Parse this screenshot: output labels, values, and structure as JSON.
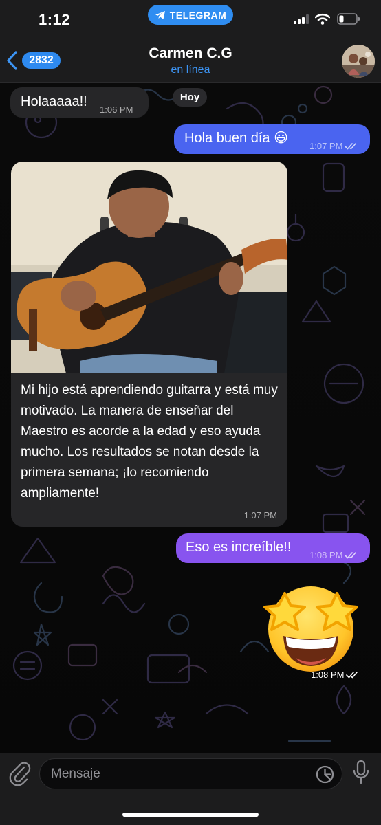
{
  "status_bar": {
    "time": "1:12",
    "pill_label": "TELEGRAM",
    "signal_icon": "cellular-signal-icon",
    "wifi_icon": "wifi-icon",
    "battery_icon": "battery-low-icon"
  },
  "header": {
    "unread_count": "2832",
    "contact_name": "Carmen C.G",
    "contact_status": "en línea",
    "back_icon": "chevron-left-icon"
  },
  "chat": {
    "date_chip": "Hoy",
    "messages": [
      {
        "direction": "incoming",
        "text": "Holaaaaa!!",
        "time": "1:06 PM"
      },
      {
        "direction": "outgoing",
        "text": "Hola buen día 😃",
        "time": "1:07 PM",
        "read": true
      },
      {
        "direction": "incoming",
        "type": "photo",
        "caption": "Mi hijo está aprendiendo guitarra y está muy motivado. La manera de enseñar del Maestro es acorde a la edad y eso ayuda mucho. Los resultados se notan desde la primera semana; ¡lo recomiendo ampliamente!",
        "time": "1:07 PM"
      },
      {
        "direction": "outgoing",
        "text": "Eso es increíble!!",
        "time": "1:08 PM",
        "read": true
      },
      {
        "direction": "outgoing",
        "type": "emoji",
        "emoji": "star-struck",
        "time": "1:08 PM",
        "read": true
      }
    ]
  },
  "input": {
    "placeholder": "Mensaje",
    "attach_icon": "paperclip-icon",
    "sticker_icon": "sticker-clock-icon",
    "mic_icon": "microphone-icon"
  },
  "colors": {
    "accent": "#2f8df1",
    "outgoing_bubble_top": "#4a64f0",
    "outgoing_bubble_bottom": "#8854ef",
    "incoming_bubble": "#262628",
    "bar_background": "#1c1c1d"
  }
}
